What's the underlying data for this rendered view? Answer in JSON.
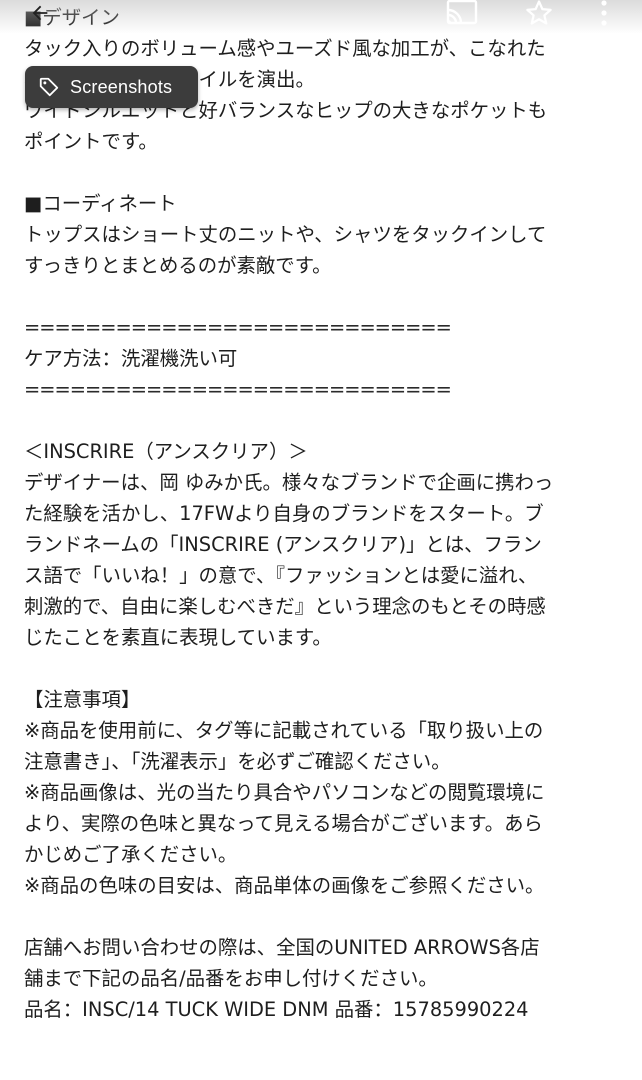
{
  "toolbar": {
    "back_icon": "arrow-back-icon",
    "cast_icon": "cast-icon",
    "star_icon": "star-outline-icon",
    "menu_icon": "more-vert-icon"
  },
  "chip": {
    "label": "Screenshots",
    "icon": "tag-icon"
  },
  "description": {
    "design_heading": "■デザイン",
    "design_lines": [
      "タック入りのボリューム感やユーズド風な加工が、こなれた",
      "雰囲気のワイドスタイルを演出。",
      "ワイドシルエットと好バランスなヒップの大きなポケットも",
      "ポイントです。"
    ],
    "coordinate_heading": "■コーディネート",
    "coordinate_lines": [
      "トップスはショート丈のニットや、シャツをタックインして",
      "すっきりとまとめるのが素敵です。"
    ],
    "separator": "============================",
    "care": "ケア方法：洗濯機洗い可",
    "brand_heading": "＜INSCRIRE（アンスクリア）＞",
    "brand_lines": [
      "デザイナーは、岡 ゆみか氏。様々なブランドで企画に携わっ",
      "た経験を活かし、17FWより自身のブランドをスタート。ブ",
      "ランドネームの「INSCRIRE (アンスクリア)」とは、フラン",
      "ス語で「いいね！」の意で、『ファッションとは愛に溢れ、",
      "刺激的で、自由に楽しむべきだ』という理念のもとその時感",
      "じたことを素直に表現しています。"
    ],
    "notice_heading": "【注意事項】",
    "notice_lines": [
      "※商品を使用前に、タグ等に記載されている「取り扱い上の",
      "注意書き」、「洗濯表示」を必ずご確認ください。",
      "※商品画像は、光の当たり具合やパソコンなどの閲覧環境に",
      "より、実際の色味と異なって見える場合がございます。あら",
      "かじめご了承ください。",
      "※商品の色味の目安は、商品単体の画像をご参照ください。"
    ],
    "contact_lines": [
      "店舗へお問い合わせの際は、全国のUNITED ARROWS各店",
      "舗まで下記の品名/品番をお申し付けください。",
      "品名：INSC/14 TUCK WIDE DNM 品番：15785990224"
    ]
  }
}
